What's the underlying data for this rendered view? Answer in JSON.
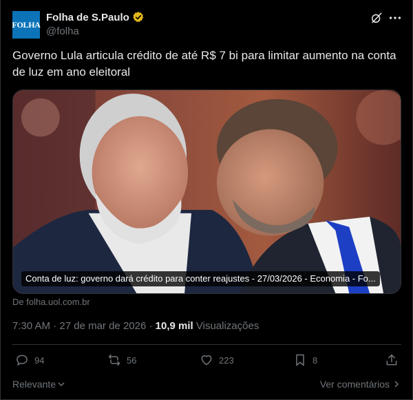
{
  "author": {
    "avatar_text": "FOLHA",
    "display_name": "Folha de S.Paulo",
    "handle": "@folha",
    "badge_icon": "verified-gold-icon",
    "badge_color": "#e2b719"
  },
  "tweet": {
    "text": "Governo Lula articula crédito de até R$ 7 bi para limitar aumento na conta de luz em ano eleitoral"
  },
  "card": {
    "caption": "Conta de luz: governo dará crédito para conter reajustes - 27/03/2026 - Economia - Fo...",
    "source": "De folha.uol.com.br"
  },
  "meta": {
    "time": "7:30 AM",
    "separator": "·",
    "date": "27 de mar de 2026",
    "views_count": "10,9 mil",
    "views_label": "Visualizações"
  },
  "actions": {
    "replies": "94",
    "reposts": "56",
    "likes": "223",
    "bookmarks": "8"
  },
  "footer": {
    "sort_label": "Relevante",
    "view_replies_label": "Ver comentários"
  },
  "colors": {
    "background": "#000000",
    "text": "#e7e9ea",
    "muted": "#71767b",
    "border": "#2f3336",
    "avatar": "#0c73b8"
  }
}
